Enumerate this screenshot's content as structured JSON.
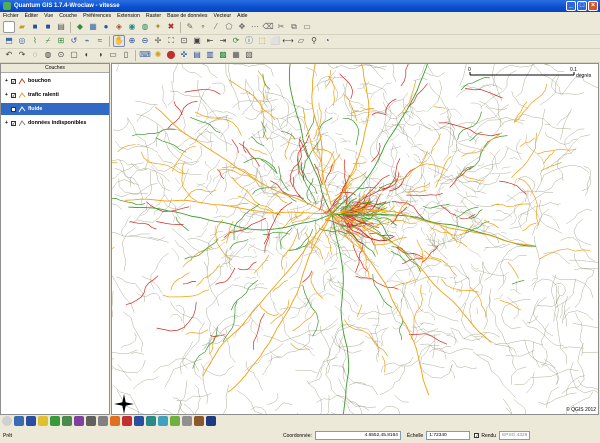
{
  "window": {
    "title": "Quantum GIS 1.7.4-Wroclaw - vitesse"
  },
  "menubar": {
    "items": [
      "Fichier",
      "Éditer",
      "Vue",
      "Couche",
      "Préférences",
      "Extension",
      "Raster",
      "Base de données",
      "Vecteur",
      "Aide"
    ]
  },
  "layers_panel": {
    "title": "Couches",
    "layers": [
      {
        "name": "bouchon",
        "checked": true,
        "selected": false,
        "color": "#c04020"
      },
      {
        "name": "trafic ralenti",
        "checked": true,
        "selected": false,
        "color": "#e0a020"
      },
      {
        "name": "fluide",
        "checked": false,
        "selected": true,
        "color": "#30a030"
      },
      {
        "name": "données indisponibles",
        "checked": true,
        "selected": false,
        "color": "#808080"
      }
    ]
  },
  "map": {
    "scale_labels": [
      "0",
      "0.1"
    ],
    "scale_unit": "degrés",
    "copyright": "© QGIS 2012",
    "colors": {
      "congestion": "#d42a1e",
      "slow": "#f0a010",
      "fluid": "#3a9a2a",
      "base": "#8a8a6a"
    }
  },
  "statusbar": {
    "ready_text": "Prêt",
    "coord_label": "Coordonnée:",
    "coord_value": "4.6552,45.8164",
    "scale_label": "Échelle",
    "scale_value": "1:72340",
    "render_label": "Rendu",
    "crs": "EPSG:4326"
  }
}
